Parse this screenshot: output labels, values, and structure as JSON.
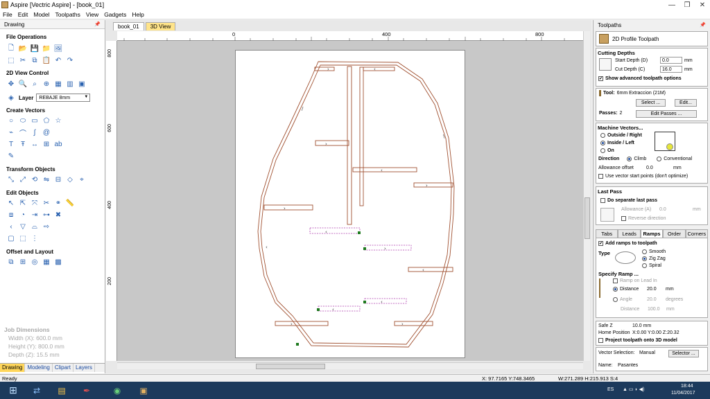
{
  "window": {
    "title": "Aspire [Vectric Aspire] - [book_01]",
    "controls": [
      "—",
      "❐",
      "✕"
    ]
  },
  "menu": [
    "File",
    "Edit",
    "Model",
    "Toolpaths",
    "View",
    "Gadgets",
    "Help"
  ],
  "left": {
    "header": "Drawing",
    "sections": {
      "file_ops": "File Operations",
      "view_ctrl": "2D View Control",
      "create_vectors": "Create Vectors",
      "transform": "Transform Objects",
      "edit_objects": "Edit Objects",
      "offset_layout": "Offset and Layout"
    },
    "layer_label": "Layer",
    "layer_value": "REBAJE 8mm",
    "job": {
      "title": "Job Dimensions",
      "width": "Width  (X): 600.0 mm",
      "height": "Height (Y): 800.0 mm",
      "depth": "Depth  (Z): 15.5 mm"
    },
    "tabs": [
      "Drawing",
      "Modeling",
      "Clipart",
      "Layers"
    ]
  },
  "doc_tabs": [
    "book_01",
    "3D View"
  ],
  "ruler": {
    "top": [
      "0",
      "400",
      "800"
    ],
    "left": [
      "800",
      "600",
      "400",
      "200"
    ]
  },
  "right": {
    "header": "Toolpaths",
    "toolpath_title": "2D Profile Toolpath",
    "cutting_depths": "Cutting Depths",
    "start_depth_label": "Start Depth (D)",
    "start_depth": "0.0",
    "cut_depth_label": "Cut Depth (C)",
    "cut_depth": "16.0",
    "unit": "mm",
    "show_advanced": "Show advanced toolpath options",
    "tool_label": "Tool:",
    "tool_value": "6mm Extraccion (21M)",
    "select_btn": "Select ...",
    "edit_btn": "Edit...",
    "passes_label": "Passes:",
    "passes_value": "2",
    "edit_passes_btn": "Edit Passes ...",
    "machine_vectors": "Machine Vectors...",
    "outside_right": "Outside / Right",
    "inside_left": "Inside / Left",
    "on": "On",
    "direction": "Direction",
    "climb": "Climb",
    "conventional": "Conventional",
    "allowance_offset": "Allowance offset",
    "allowance_value": "0.0",
    "use_vector_start": "Use vector start points (don't optimize)",
    "last_pass": "Last Pass",
    "do_separate": "Do separate last pass",
    "allowance_a": "Allowance (A)",
    "allowance_a_value": "0.0",
    "reverse_direction": "Reverse direction",
    "tabs": [
      "Tabs",
      "Leads",
      "Ramps",
      "Order",
      "Corners"
    ],
    "add_ramps": "Add ramps to toolpath",
    "type_label": "Type",
    "smooth": "Smooth",
    "zigzag": "Zig Zag",
    "spiral": "Spiral",
    "specify_ramp": "Specify Ramp ...",
    "ramp_on_lead": "Ramp on Lead In",
    "distance_label": "Distance",
    "distance_value": "20.0",
    "angle_label": "Angle",
    "angle_value": "20.0",
    "degrees": "degrees",
    "distance2_label": "Distance",
    "distance2_value": "100.0",
    "safe_z": "Safe Z",
    "safe_z_value": "10.0 mm",
    "home_position": "Home Position",
    "home_value": "X:0.00 Y:0.00 Z:20.32",
    "project_3d": "Project toolpath onto 3D model",
    "vector_selection": "Vector Selection:",
    "vector_selection_value": "Manual",
    "selector_btn": "Selector ...",
    "name_label": "Name:",
    "name_value": "Pasantes"
  },
  "status": {
    "ready": "Ready",
    "coords": "X: 97.7165 Y:748.3465",
    "size": "W:271.289  H:215.913  S:4"
  },
  "taskbar": {
    "lang": "ES",
    "time": "18:44",
    "date": "11/04/2017"
  }
}
